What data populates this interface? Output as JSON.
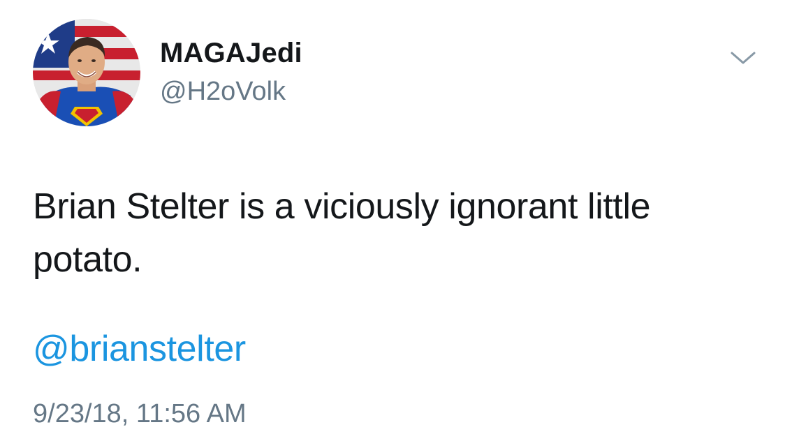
{
  "tweet": {
    "author": {
      "display_name": "MAGAJedi",
      "handle": "@H2oVolk",
      "avatar_icon": "avatar-superhero-flag"
    },
    "menu_icon": "chevron-down-icon",
    "text": "Brian Stelter is a viciously ignorant little potato.",
    "mention": "@brianstelter",
    "timestamp": "9/23/18, 11:56 AM"
  },
  "colors": {
    "text_primary": "#14171a",
    "text_secondary": "#657786",
    "link": "#1b95e0",
    "background": "#ffffff"
  }
}
